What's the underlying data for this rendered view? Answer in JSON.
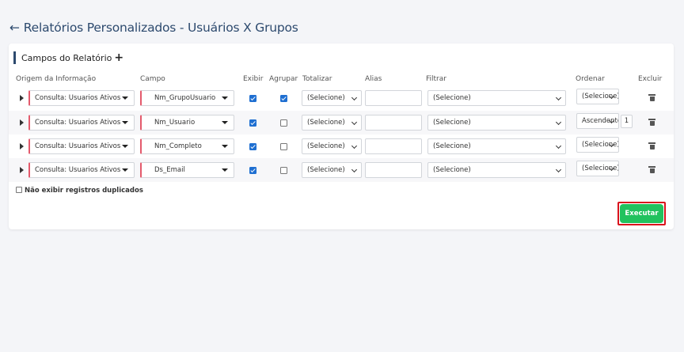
{
  "page": {
    "back_icon": "←",
    "title": "Relatórios Personalizados - Usuários X Grupos"
  },
  "card": {
    "header": "Campos do Relatório",
    "add_icon": "+"
  },
  "columns": [
    "Origem da Informação",
    "Campo",
    "Exibir",
    "Agrupar",
    "Totalizar",
    "Alias",
    "Filtrar",
    "Ordenar",
    "Excluir"
  ],
  "rows": [
    {
      "origem": "Consulta: Usuarios Ativos",
      "campo": "Nm_GrupoUsuario",
      "exibir": true,
      "agrupar": true,
      "totalizar": "(Selecione)",
      "alias": "",
      "filtrar": "(Selecione)",
      "ordenar": "(Selecione)",
      "ordem": ""
    },
    {
      "origem": "Consulta: Usuarios Ativos",
      "campo": "Nm_Usuario",
      "exibir": true,
      "agrupar": false,
      "totalizar": "(Selecione)",
      "alias": "",
      "filtrar": "(Selecione)",
      "ordenar": "Ascendente",
      "ordem": "1"
    },
    {
      "origem": "Consulta: Usuarios Ativos",
      "campo": "Nm_Completo",
      "exibir": true,
      "agrupar": false,
      "totalizar": "(Selecione)",
      "alias": "",
      "filtrar": "(Selecione)",
      "ordenar": "(Selecione)",
      "ordem": ""
    },
    {
      "origem": "Consulta: Usuarios Ativos",
      "campo": "Ds_Email",
      "exibir": true,
      "agrupar": false,
      "totalizar": "(Selecione)",
      "alias": "",
      "filtrar": "(Selecione)",
      "ordenar": "(Selecione)",
      "ordem": ""
    }
  ],
  "options": {
    "no_duplicates_label": "Não exibir registros duplicados",
    "no_duplicates_checked": false
  },
  "actions": {
    "execute_label": "Executar"
  },
  "colors": {
    "title": "#2d4a6e",
    "checkbox_on": "#1f6fd1",
    "required_marker": "#e45a6c",
    "execute_button": "#21c25e",
    "highlight_outline": "#d9121c"
  }
}
